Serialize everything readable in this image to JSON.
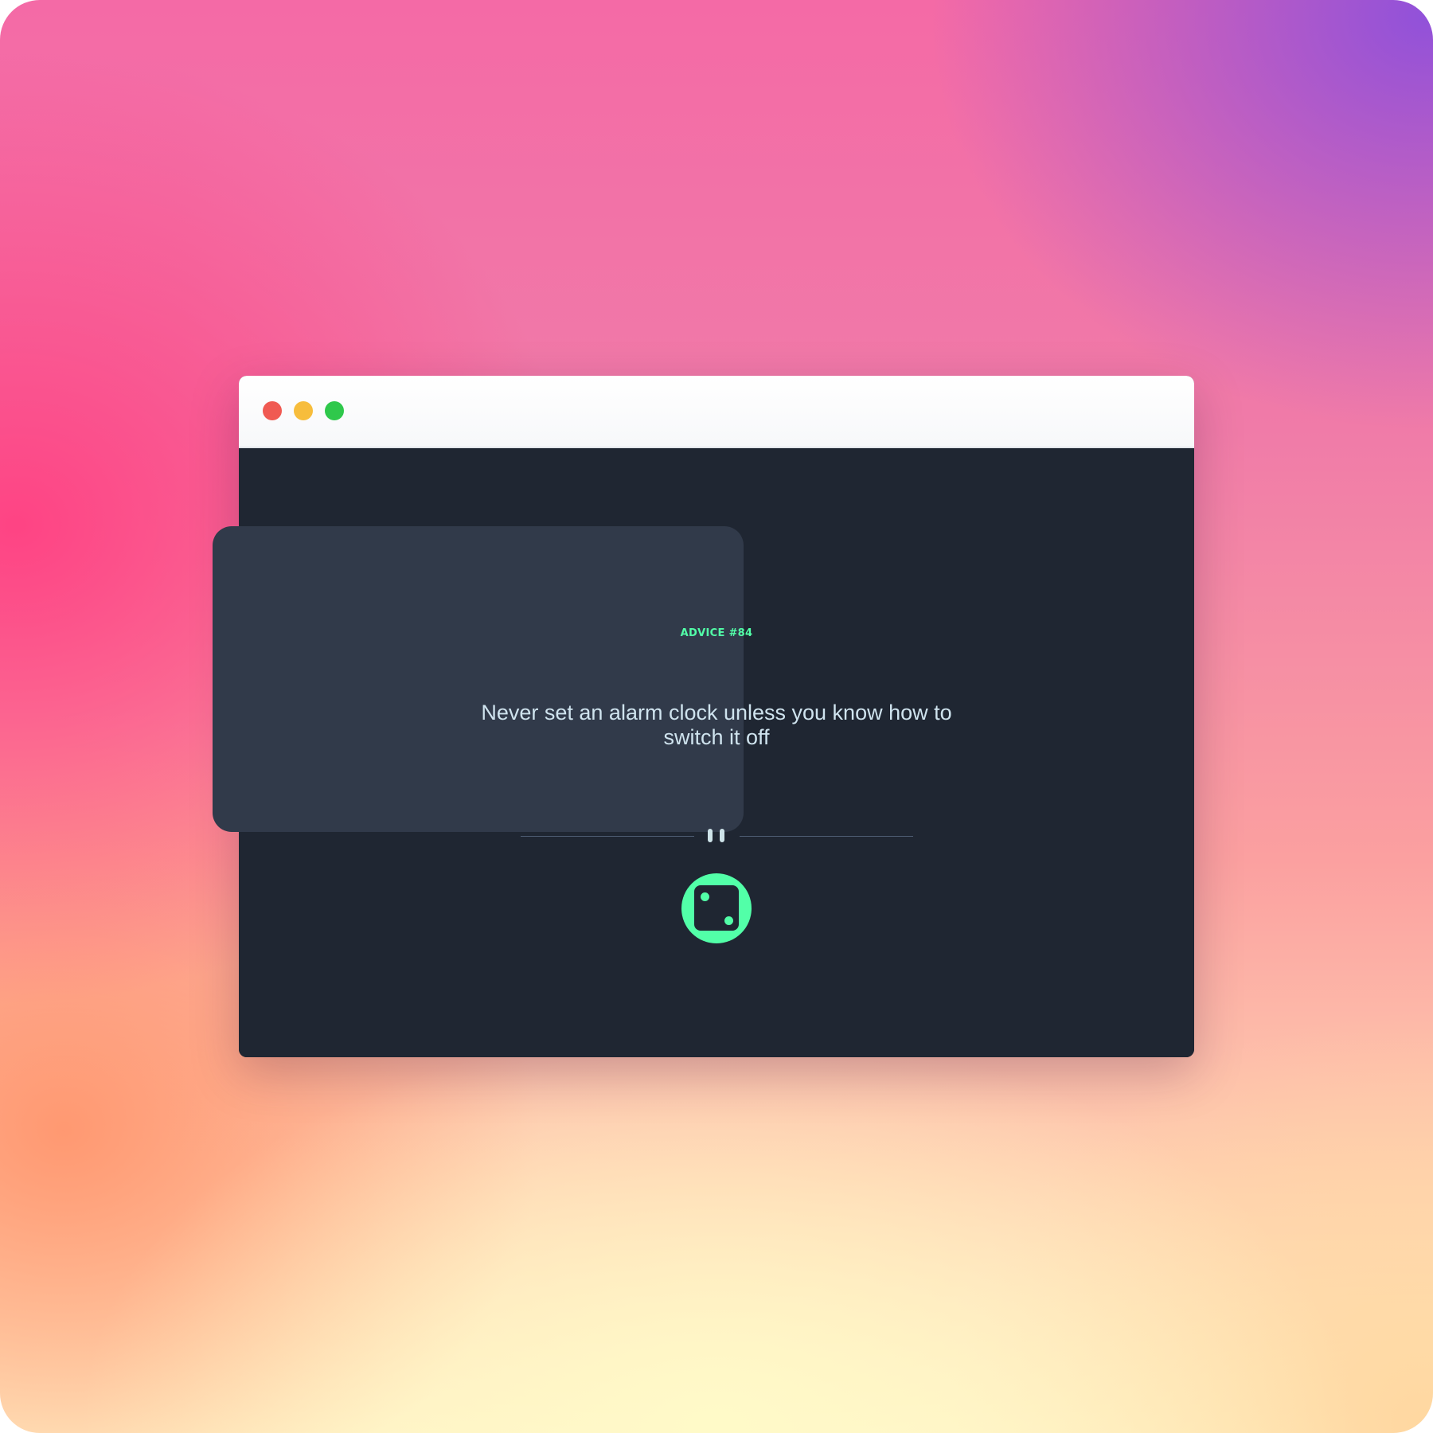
{
  "window": {
    "controls": [
      "close",
      "minimize",
      "maximize"
    ]
  },
  "advice": {
    "id_label": "ADVICE #84",
    "quote": "Never set an alarm clock unless you know how to switch it off"
  },
  "divider": {
    "icon": "pause-icon"
  },
  "dice_button": {
    "icon": "dice-icon"
  },
  "colors": {
    "accent": "#52ffa8",
    "page_background": "#1f2632",
    "card_background": "#313a4a",
    "quote_text": "#cfe3ee",
    "close_dot": "#f05a52",
    "minimize_dot": "#f7bd3c",
    "maximize_dot": "#2fc84b"
  }
}
